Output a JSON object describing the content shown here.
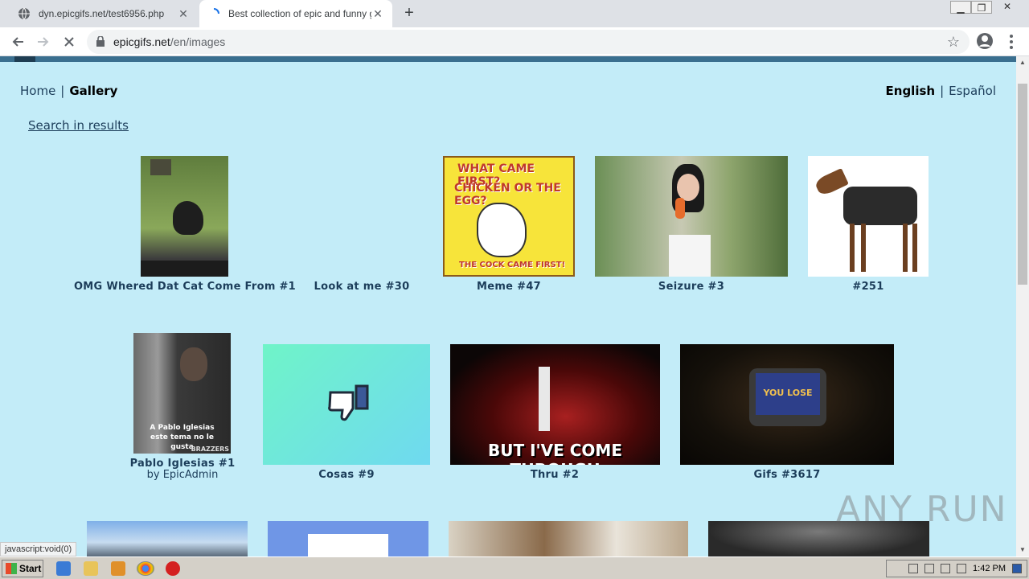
{
  "browser": {
    "tabs": [
      {
        "title": "dyn.epicgifs.net/test6956.php",
        "active": false
      },
      {
        "title": "Best collection of epic and funny gifs",
        "active": true
      }
    ],
    "url_host": "epicgifs.net",
    "url_path": "/en/images"
  },
  "nav": {
    "home": "Home",
    "gallery": "Gallery",
    "separator": "|"
  },
  "languages": {
    "english": "English",
    "spanish": "Español",
    "separator": "|"
  },
  "search_link": "Search in results",
  "gallery": {
    "row1": [
      {
        "caption": "OMG Whered Dat Cat Come From #1"
      },
      {
        "caption": "Look at me #30"
      },
      {
        "caption": "Meme #47",
        "meme_line1": "WHAT CAME FIRST?",
        "meme_line2": "CHICKEN OR THE EGG?",
        "meme_bottom": "THE COCK CAME FIRST!"
      },
      {
        "caption": "Seizure #3"
      },
      {
        "caption": "#251"
      }
    ],
    "row2": [
      {
        "caption": "Pablo Iglesias #1",
        "byline": "by EpicAdmin",
        "overlay": "A Pablo Iglesias este tema no le gusta",
        "brand": "BRAZZERS"
      },
      {
        "caption": "Cosas #9"
      },
      {
        "caption": "Thru #2",
        "overlay": "BUT I'VE COME THROUGH"
      },
      {
        "caption": "Gifs #3617",
        "screen_text": "YOU LOSE"
      }
    ]
  },
  "status_bar": "javascript:void(0)",
  "watermark": "ANY RUN",
  "taskbar": {
    "start": "Start",
    "clock": "1:42 PM"
  },
  "colors": {
    "page_bg": "#c3ecf8",
    "link": "#1c3d5a"
  }
}
